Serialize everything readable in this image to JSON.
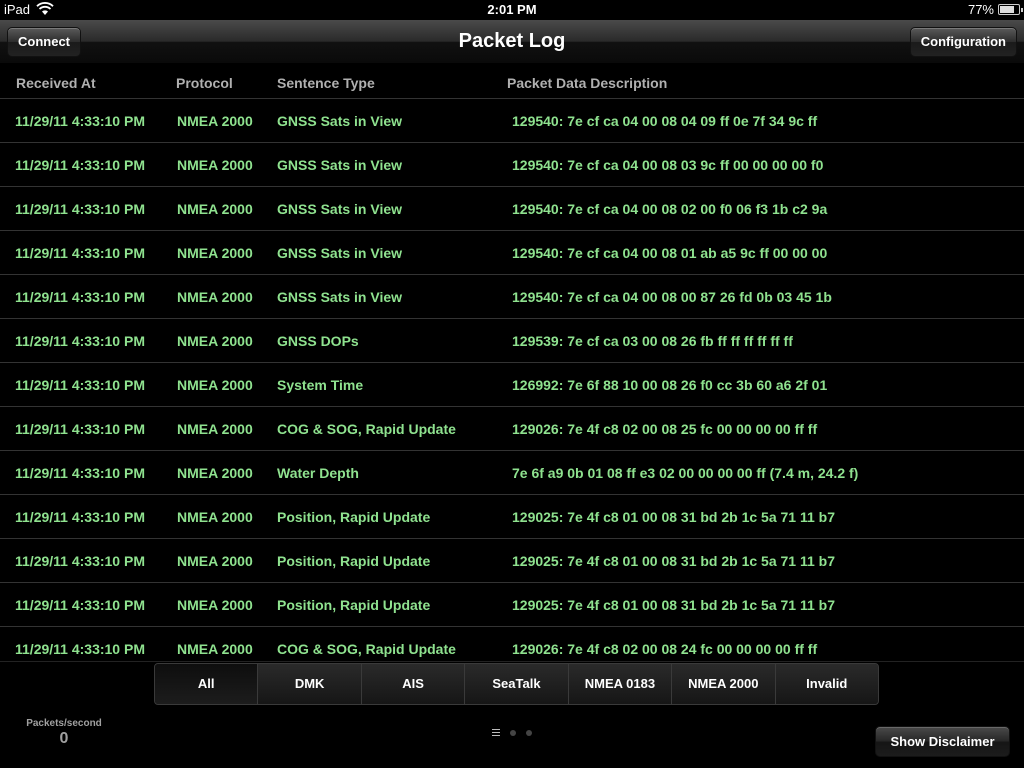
{
  "status_bar": {
    "device": "iPad",
    "time": "2:01 PM",
    "battery_percent": "77%",
    "battery_level": 0.77,
    "wifi_icon": "wifi-icon",
    "battery_icon": "battery-icon"
  },
  "nav": {
    "title": "Packet Log",
    "left_button": "Connect",
    "right_button": "Configuration"
  },
  "columns": {
    "received_at": "Received At",
    "protocol": "Protocol",
    "sentence_type": "Sentence Type",
    "description": "Packet Data Description"
  },
  "rows": [
    {
      "time": "11/29/11 4:33:10 PM",
      "protocol": "NMEA 2000",
      "type": "GNSS Sats in View",
      "desc": "129540: 7e cf ca 04 00 08 04 09 ff 0e 7f 34 9c ff"
    },
    {
      "time": "11/29/11 4:33:10 PM",
      "protocol": "NMEA 2000",
      "type": "GNSS Sats in View",
      "desc": "129540: 7e cf ca 04 00 08 03 9c ff 00 00 00 00 f0"
    },
    {
      "time": "11/29/11 4:33:10 PM",
      "protocol": "NMEA 2000",
      "type": "GNSS Sats in View",
      "desc": "129540: 7e cf ca 04 00 08 02 00 f0 06 f3 1b c2 9a"
    },
    {
      "time": "11/29/11 4:33:10 PM",
      "protocol": "NMEA 2000",
      "type": "GNSS Sats in View",
      "desc": "129540: 7e cf ca 04 00 08 01 ab a5 9c ff 00 00 00"
    },
    {
      "time": "11/29/11 4:33:10 PM",
      "protocol": "NMEA 2000",
      "type": "GNSS Sats in View",
      "desc": "129540: 7e cf ca 04 00 08 00 87 26 fd 0b 03 45 1b"
    },
    {
      "time": "11/29/11 4:33:10 PM",
      "protocol": "NMEA 2000",
      "type": "GNSS DOPs",
      "desc": "129539: 7e cf ca 03 00 08 26 fb ff ff ff ff ff ff"
    },
    {
      "time": "11/29/11 4:33:10 PM",
      "protocol": "NMEA 2000",
      "type": "System Time",
      "desc": "126992: 7e 6f 88 10 00 08 26 f0 cc 3b 60 a6 2f 01"
    },
    {
      "time": "11/29/11 4:33:10 PM",
      "protocol": "NMEA 2000",
      "type": "COG & SOG, Rapid Update",
      "desc": "129026: 7e 4f c8 02 00 08 25 fc 00 00 00 00 ff ff"
    },
    {
      "time": "11/29/11 4:33:10 PM",
      "protocol": "NMEA 2000",
      "type": "Water Depth",
      "desc": "7e 6f a9 0b 01 08 ff e3 02 00 00 00 00 ff   (7.4 m, 24.2 f)"
    },
    {
      "time": "11/29/11 4:33:10 PM",
      "protocol": "NMEA 2000",
      "type": "Position, Rapid Update",
      "desc": "129025: 7e 4f c8 01 00 08 31 bd 2b 1c 5a 71 11 b7"
    },
    {
      "time": "11/29/11 4:33:10 PM",
      "protocol": "NMEA 2000",
      "type": "Position, Rapid Update",
      "desc": "129025: 7e 4f c8 01 00 08 31 bd 2b 1c 5a 71 11 b7"
    },
    {
      "time": "11/29/11 4:33:10 PM",
      "protocol": "NMEA 2000",
      "type": "Position, Rapid Update",
      "desc": "129025: 7e 4f c8 01 00 08 31 bd 2b 1c 5a 71 11 b7"
    },
    {
      "time": "11/29/11 4:33:10 PM",
      "protocol": "NMEA 2000",
      "type": "COG & SOG, Rapid Update",
      "desc": "129026: 7e 4f c8 02 00 08 24 fc 00 00 00 00 ff ff"
    }
  ],
  "filters": [
    {
      "label": "All",
      "selected": true
    },
    {
      "label": "DMK",
      "selected": false
    },
    {
      "label": "AIS",
      "selected": false
    },
    {
      "label": "SeaTalk",
      "selected": false
    },
    {
      "label": "NMEA 0183",
      "selected": false
    },
    {
      "label": "NMEA 2000",
      "selected": false
    },
    {
      "label": "Invalid",
      "selected": false
    }
  ],
  "packets_per_second": {
    "label": "Packets/second",
    "value": "0"
  },
  "page_indicator": {
    "current_page": 1,
    "page_count": 3
  },
  "disclaimer_button": "Show Disclaimer",
  "colors": {
    "row_text": "#8fe28f",
    "header_text": "#b0b0b0",
    "background": "#000000"
  }
}
